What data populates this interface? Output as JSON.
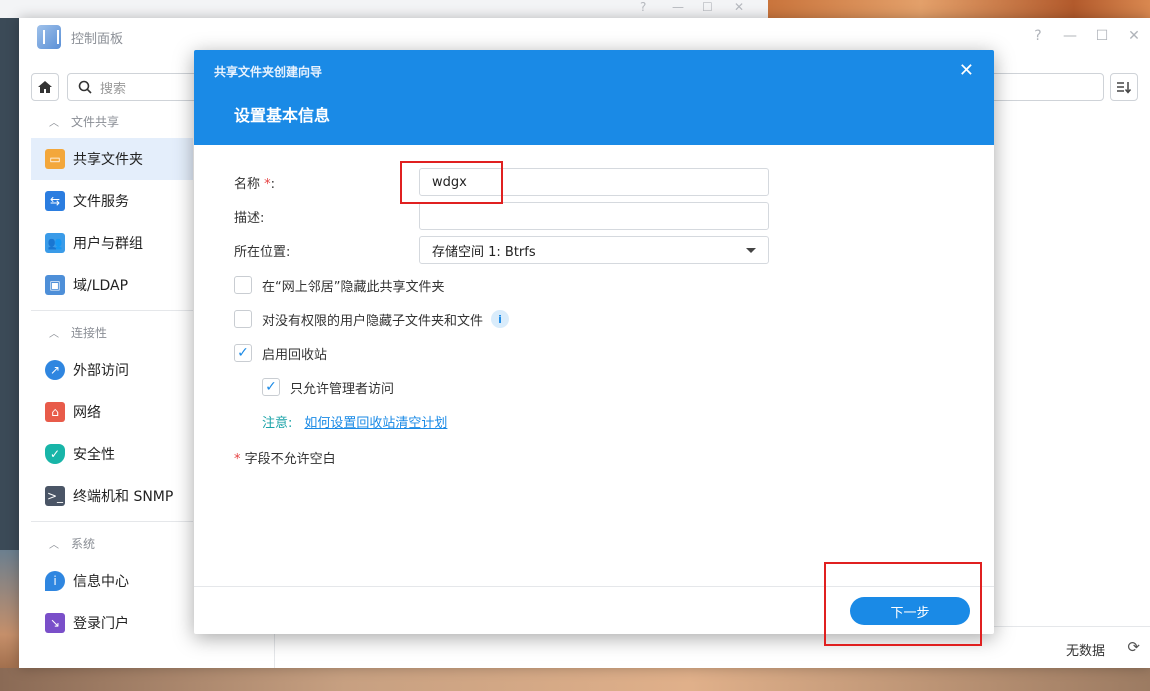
{
  "control_panel": {
    "title": "控制面板",
    "search_placeholder": "搜索",
    "window_controls": [
      "?",
      "—",
      "☐",
      "✕"
    ]
  },
  "sidebar": {
    "sections": [
      {
        "label": "文件共享",
        "items": [
          {
            "label": "共享文件夹",
            "icon": "folder-icon",
            "active": true
          },
          {
            "label": "文件服务",
            "icon": "file-services-icon"
          },
          {
            "label": "用户与群组",
            "icon": "users-icon"
          },
          {
            "label": "域/LDAP",
            "icon": "ldap-icon"
          }
        ]
      },
      {
        "label": "连接性",
        "items": [
          {
            "label": "外部访问",
            "icon": "external-access-icon"
          },
          {
            "label": "网络",
            "icon": "network-icon"
          },
          {
            "label": "安全性",
            "icon": "shield-icon"
          },
          {
            "label": "终端机和 SNMP",
            "icon": "terminal-icon"
          }
        ]
      },
      {
        "label": "系统",
        "items": [
          {
            "label": "信息中心",
            "icon": "info-center-icon"
          },
          {
            "label": "登录门户",
            "icon": "login-portal-icon"
          }
        ]
      }
    ]
  },
  "main_footer": {
    "status": "无数据"
  },
  "wizard": {
    "subtitle": "共享文件夹创建向导",
    "title": "设置基本信息",
    "name_label": "名称",
    "name_required_mark": "*",
    "name_colon": ":",
    "name_value": "wdgx",
    "description_label": "描述:",
    "description_value": "",
    "location_label": "所在位置:",
    "location_value": "存储空间 1:  Btrfs",
    "checkboxes": [
      {
        "label": "在“网上邻居”隐藏此共享文件夹",
        "checked": false
      },
      {
        "label": "对没有权限的用户隐藏子文件夹和文件",
        "checked": false
      },
      {
        "label": "启用回收站",
        "checked": true
      },
      {
        "label": "只允许管理者访问",
        "checked": true
      }
    ],
    "note_label": "注意:",
    "note_link": "如何设置回收站清空计划",
    "required_note_mark": "*",
    "required_note": "字段不允许空白",
    "next_button": "下一步"
  },
  "colors": {
    "accent": "#1a8ae6",
    "highlight": "#e02020",
    "required": "#e64040"
  }
}
